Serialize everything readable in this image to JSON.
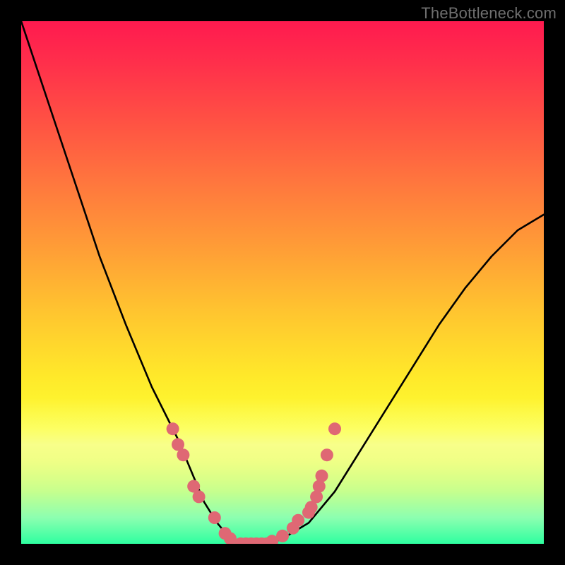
{
  "watermark": {
    "text": "TheBottleneck.com"
  },
  "colors": {
    "dot": "#df6874",
    "curve": "#000000",
    "frame": "#000000"
  },
  "chart_data": {
    "type": "line",
    "title": "",
    "xlabel": "",
    "ylabel": "",
    "xlim": [
      0,
      100
    ],
    "ylim": [
      0,
      100
    ],
    "x": [
      0,
      5,
      10,
      15,
      20,
      25,
      27.5,
      30,
      32.5,
      35,
      37.5,
      40,
      42.5,
      45,
      47.5,
      50,
      55,
      60,
      65,
      70,
      75,
      80,
      85,
      90,
      95,
      100
    ],
    "values": [
      100,
      85,
      70,
      55,
      42,
      30,
      25,
      20,
      14,
      8,
      4,
      1,
      0,
      0,
      0,
      1,
      4,
      10,
      18,
      26,
      34,
      42,
      49,
      55,
      60,
      63
    ],
    "series": [
      {
        "name": "bottleneck-curve",
        "x": [
          0,
          5,
          10,
          15,
          20,
          25,
          27.5,
          30,
          32.5,
          35,
          37.5,
          40,
          42.5,
          45,
          47.5,
          50,
          55,
          60,
          65,
          70,
          75,
          80,
          85,
          90,
          95,
          100
        ],
        "values": [
          100,
          85,
          70,
          55,
          42,
          30,
          25,
          20,
          14,
          8,
          4,
          1,
          0,
          0,
          0,
          1,
          4,
          10,
          18,
          26,
          34,
          42,
          49,
          55,
          60,
          63
        ]
      }
    ],
    "dots": [
      {
        "x": 29,
        "y": 22
      },
      {
        "x": 30,
        "y": 19
      },
      {
        "x": 31,
        "y": 17
      },
      {
        "x": 33,
        "y": 11
      },
      {
        "x": 34,
        "y": 9
      },
      {
        "x": 37,
        "y": 5
      },
      {
        "x": 39,
        "y": 2
      },
      {
        "x": 40,
        "y": 1
      },
      {
        "x": 42,
        "y": 0
      },
      {
        "x": 43,
        "y": 0
      },
      {
        "x": 44,
        "y": 0
      },
      {
        "x": 45,
        "y": 0
      },
      {
        "x": 46,
        "y": 0
      },
      {
        "x": 47,
        "y": 0
      },
      {
        "x": 48,
        "y": 0.5
      },
      {
        "x": 50,
        "y": 1.5
      },
      {
        "x": 52,
        "y": 3
      },
      {
        "x": 53,
        "y": 4.5
      },
      {
        "x": 55,
        "y": 6
      },
      {
        "x": 55.5,
        "y": 7
      },
      {
        "x": 56.5,
        "y": 9
      },
      {
        "x": 57,
        "y": 11
      },
      {
        "x": 57.5,
        "y": 13
      },
      {
        "x": 58.5,
        "y": 17
      },
      {
        "x": 60,
        "y": 22
      }
    ]
  }
}
